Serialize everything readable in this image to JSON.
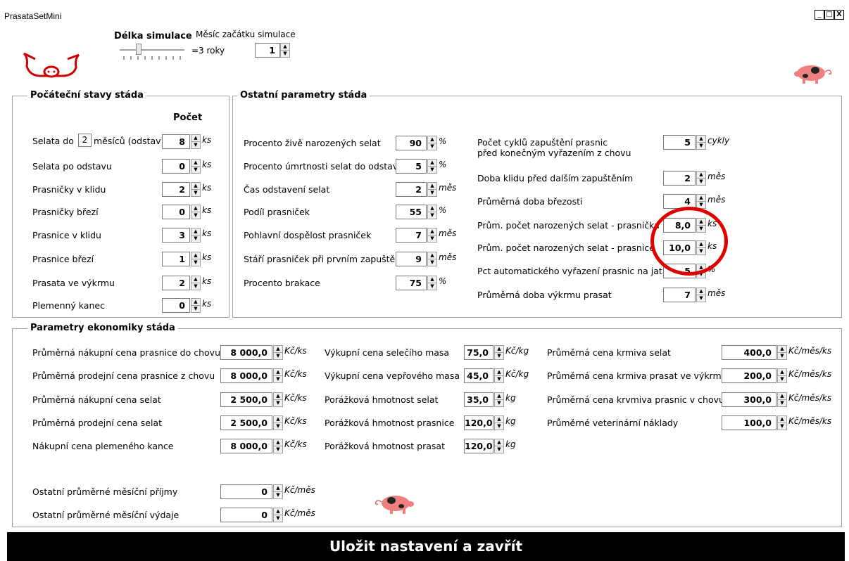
{
  "window": {
    "title": "PrasataSetMini",
    "minimize": "_",
    "maximize": "□",
    "close": "X"
  },
  "simulation": {
    "length_label": "Délka simulace",
    "length_value": "=3 roky",
    "start_label": "Měsíc začátku simulace",
    "start_value": "1"
  },
  "initial": {
    "title": "Počáteční stavy stáda",
    "header": "Počet",
    "piglets_label_prefix": "Selata do",
    "piglets_months": "2",
    "piglets_label_suffix": "měsíců (odstav)",
    "rows": [
      {
        "label": "",
        "value": "8",
        "unit": "ks"
      },
      {
        "label": "Selata po odstavu",
        "value": "0",
        "unit": "ks"
      },
      {
        "label": "Prasničky v klidu",
        "value": "2",
        "unit": "ks"
      },
      {
        "label": "Prasničky březí",
        "value": "0",
        "unit": "ks"
      },
      {
        "label": "Prasnice v klidu",
        "value": "3",
        "unit": "ks"
      },
      {
        "label": "Prasnice březí",
        "value": "1",
        "unit": "ks"
      },
      {
        "label": "Prasata ve výkrmu",
        "value": "2",
        "unit": "ks"
      },
      {
        "label": "Plemenný kanec",
        "value": "0",
        "unit": "ks"
      }
    ]
  },
  "other": {
    "title": "Ostatní parametry stáda",
    "left": [
      {
        "label": "Procento živě narozených selat",
        "value": "90",
        "unit": "%"
      },
      {
        "label": "Procento úmrtnosti selat do odstavu",
        "value": "5",
        "unit": "%"
      },
      {
        "label": "Čas odstavení selat",
        "value": "2",
        "unit": "měs"
      },
      {
        "label": "Podíl prasniček",
        "value": "55",
        "unit": "%"
      },
      {
        "label": "Pohlavní dospělost prasniček",
        "value": "7",
        "unit": "měs"
      },
      {
        "label": "Stáří prasniček při prvním zapuštění",
        "value": "9",
        "unit": "měs"
      },
      {
        "label": "Procento brakace",
        "value": "75",
        "unit": "%"
      }
    ],
    "right": [
      {
        "label": "Počet cyklů zapuštění prasnic",
        "label2": "před konečným vyřazením z chovu",
        "value": "5",
        "unit": "cykly"
      },
      {
        "label": "Doba klidu před dalším zapuštěním",
        "value": "2",
        "unit": "měs"
      },
      {
        "label": "Průměrná doba březosti",
        "value": "4",
        "unit": "měs"
      },
      {
        "label": "Prům. počet narozených selat -  prasnička",
        "value": "8,0",
        "unit": "ks"
      },
      {
        "label": "Prům. počet narozených selat -  prasnice",
        "value": "10,0",
        "unit": "ks"
      },
      {
        "label": "Pct automatického vyřazení prasnic na jatka",
        "value": "5",
        "unit": "%"
      },
      {
        "label": "Průměrná doba výkrmu prasat",
        "value": "7",
        "unit": "měs"
      }
    ]
  },
  "economy": {
    "title": "Parametry ekonomiky stáda",
    "col1": [
      {
        "label": "Průměrná nákupní cena prasnice do chovu",
        "value": "8 000,0",
        "unit": "Kč/ks"
      },
      {
        "label": "Průměrná prodejní cena prasnice z chovu",
        "value": "8 000,0",
        "unit": "Kč/ks"
      },
      {
        "label": "Průměrná nákupní cena selat",
        "value": "2 500,0",
        "unit": "Kč/ks"
      },
      {
        "label": "Průměrná prodejní cena selat",
        "value": "2 500,0",
        "unit": "Kč/ks"
      },
      {
        "label": "Nákupní cena plemeného  kance",
        "value": "8 000,0",
        "unit": "Kč/ks"
      }
    ],
    "col2": [
      {
        "label": "Výkupní cena selečího masa",
        "value": "75,0",
        "unit": "Kč/kg"
      },
      {
        "label": "Výkupní cena vepřového masa",
        "value": "45,0",
        "unit": "Kč/kg"
      },
      {
        "label": "Porážková hmotnost selat",
        "value": "35,0",
        "unit": "kg"
      },
      {
        "label": "Porážková hmotnost prasnice",
        "value": "120,0",
        "unit": "kg"
      },
      {
        "label": "Porážková hmotnost prasat",
        "value": "120,0",
        "unit": "kg"
      }
    ],
    "col3": [
      {
        "label": "Průměrná cena krmiva selat",
        "value": "400,0",
        "unit": "Kč/měs/ks"
      },
      {
        "label": "Průměrná cena krmiva prasat ve výkrmu",
        "value": "200,0",
        "unit": "Kč/měs/ks"
      },
      {
        "label": "Průměrná cena krvmiva prasnic v chovu",
        "value": "300,0",
        "unit": "Kč/měs/ks"
      },
      {
        "label": "Průměrné veterinární náklady",
        "value": "100,0",
        "unit": "Kč/měs/ks"
      }
    ],
    "monthly": [
      {
        "label": "Ostatní průměrné měsíční příjmy",
        "value": "0",
        "unit": "Kč/měs"
      },
      {
        "label": "Ostatní průměrné měsíční výdaje",
        "value": "0",
        "unit": "Kč/měs"
      }
    ]
  },
  "save_button": "Uložit nastavení a zavřít",
  "colors": {
    "pig_pink": "#f08080",
    "highlight": "#e00000"
  }
}
